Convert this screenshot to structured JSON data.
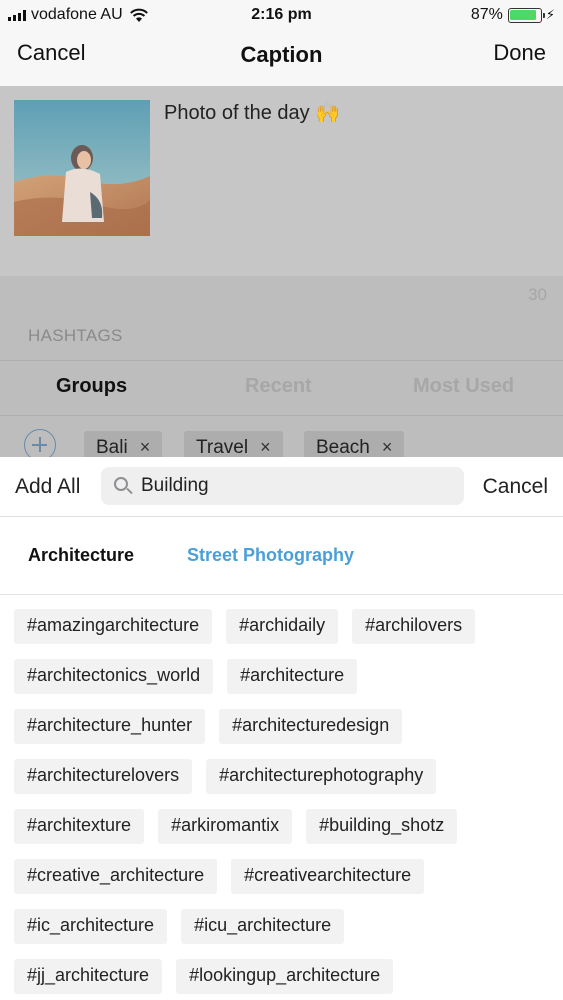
{
  "status_bar": {
    "carrier": "vodafone AU",
    "time": "2:16 pm",
    "battery_percent": "87%",
    "battery_level": 0.87,
    "battery_color": "#4cd964"
  },
  "nav": {
    "cancel": "Cancel",
    "title": "Caption",
    "done": "Done"
  },
  "caption": {
    "text": "Photo of the day 🙌",
    "char_count": "30"
  },
  "hashtags": {
    "label": "HASHTAGS",
    "tabs": [
      "Groups",
      "Recent",
      "Most Used"
    ],
    "groups": [
      {
        "label": "Bali",
        "remove": "×"
      },
      {
        "label": "Travel",
        "remove": "×"
      },
      {
        "label": "Beach",
        "remove": "×"
      }
    ]
  },
  "search": {
    "add_all": "Add All",
    "value": "Building",
    "cancel": "Cancel"
  },
  "categories": [
    {
      "label": "Architecture",
      "active": true
    },
    {
      "label": "Street Photography",
      "active": false,
      "color": "#4a9fd8"
    }
  ],
  "tags": [
    [
      "#amazingarchitecture",
      "#archidaily",
      "#archilovers"
    ],
    [
      "#architectonics_world",
      "#architecture"
    ],
    [
      "#architecture_hunter",
      "#architecturedesign"
    ],
    [
      "#architecturelovers",
      "#architecturephotography"
    ],
    [
      "#architexture",
      "#arkiromantix",
      "#building_shotz"
    ],
    [
      "#creative_architecture",
      "#creativearchitecture"
    ],
    [
      "#ic_architecture",
      "#icu_architecture"
    ],
    [
      "#jj_architecture",
      "#lookingup_architecture"
    ]
  ]
}
